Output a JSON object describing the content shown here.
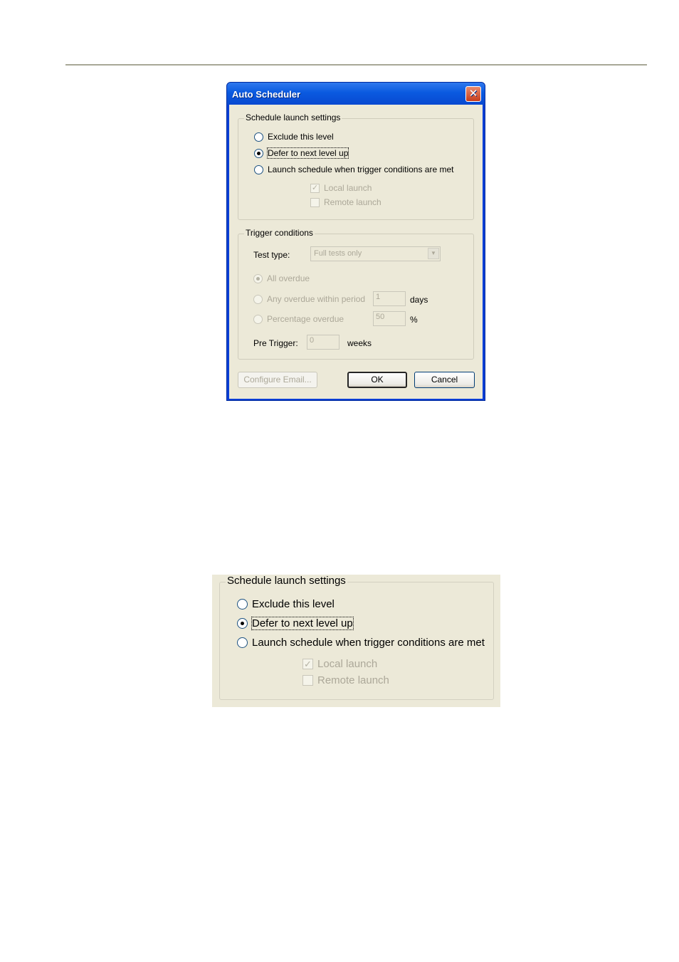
{
  "dialog": {
    "title": "Auto Scheduler",
    "close_glyph": "✕",
    "schedule_group": {
      "legend": "Schedule launch settings",
      "options": [
        {
          "label": "Exclude this level",
          "selected": false
        },
        {
          "label": "Defer to next level up",
          "selected": true
        },
        {
          "label": "Launch schedule when trigger conditions are met",
          "selected": false
        }
      ],
      "local_launch": {
        "label": "Local launch",
        "checked": true,
        "enabled": false
      },
      "remote_launch": {
        "label": "Remote launch",
        "checked": false,
        "enabled": false
      }
    },
    "trigger_group": {
      "legend": "Trigger conditions",
      "test_type_label": "Test type:",
      "test_type_value": "Full tests only",
      "all_overdue": "All overdue",
      "any_overdue": "Any overdue within period",
      "any_overdue_value": "1",
      "days_unit": "days",
      "percentage_overdue": "Percentage overdue",
      "percentage_value": "50",
      "percent_unit": "%",
      "pre_trigger_label": "Pre Trigger:",
      "pre_trigger_value": "0",
      "weeks_unit": "weeks"
    },
    "buttons": {
      "configure_email": "Configure Email...",
      "ok": "OK",
      "cancel": "Cancel"
    }
  },
  "zoom": {
    "legend": "Schedule launch settings",
    "options": [
      {
        "label": "Exclude this level"
      },
      {
        "label": "Defer to next level up"
      },
      {
        "label": "Launch schedule when trigger conditions are met"
      }
    ],
    "local_launch": "Local launch",
    "remote_launch": "Remote launch"
  },
  "icons": {
    "check_glyph": "✓",
    "dropdown_glyph": "▼"
  }
}
